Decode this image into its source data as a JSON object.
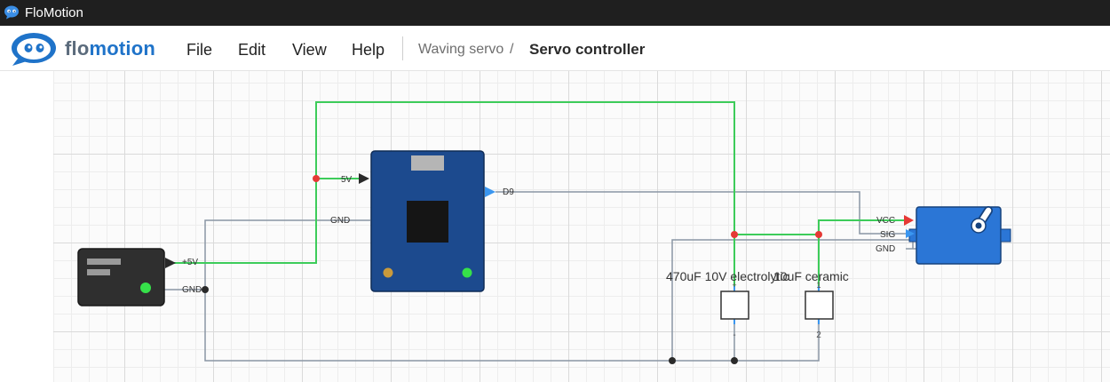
{
  "window": {
    "title": "FloMotion",
    "icon": "flomotion-logo-icon"
  },
  "header": {
    "logo_part1": "flo",
    "logo_part2": "motion",
    "menu": [
      "File",
      "Edit",
      "View",
      "Help"
    ],
    "breadcrumb": {
      "project": "Waving servo",
      "separator": "/",
      "page": "Servo controller"
    }
  },
  "schematic": {
    "power_supply": {
      "pins": [
        "+5V",
        "GND"
      ]
    },
    "arduino": {
      "pins": [
        "5V",
        "GND",
        "D9"
      ]
    },
    "servo": {
      "pins": [
        "VCC",
        "SIG",
        "GND"
      ]
    },
    "capacitor_1": {
      "label": "470uF 10V electrolytic",
      "pin_labels": [
        "+",
        "-"
      ]
    },
    "capacitor_2": {
      "label": "10uF ceramic",
      "pin_labels": [
        "1",
        "2"
      ]
    }
  },
  "colors": {
    "power_wire": "#3dcc5a",
    "signal_wire": "#8a96a4",
    "arduino_board": "#1c4a8e",
    "servo_body": "#2b76d6",
    "supply_body": "#2f2f2f",
    "junction_power": "#e53935",
    "junction_ground": "#2a2a2a"
  }
}
